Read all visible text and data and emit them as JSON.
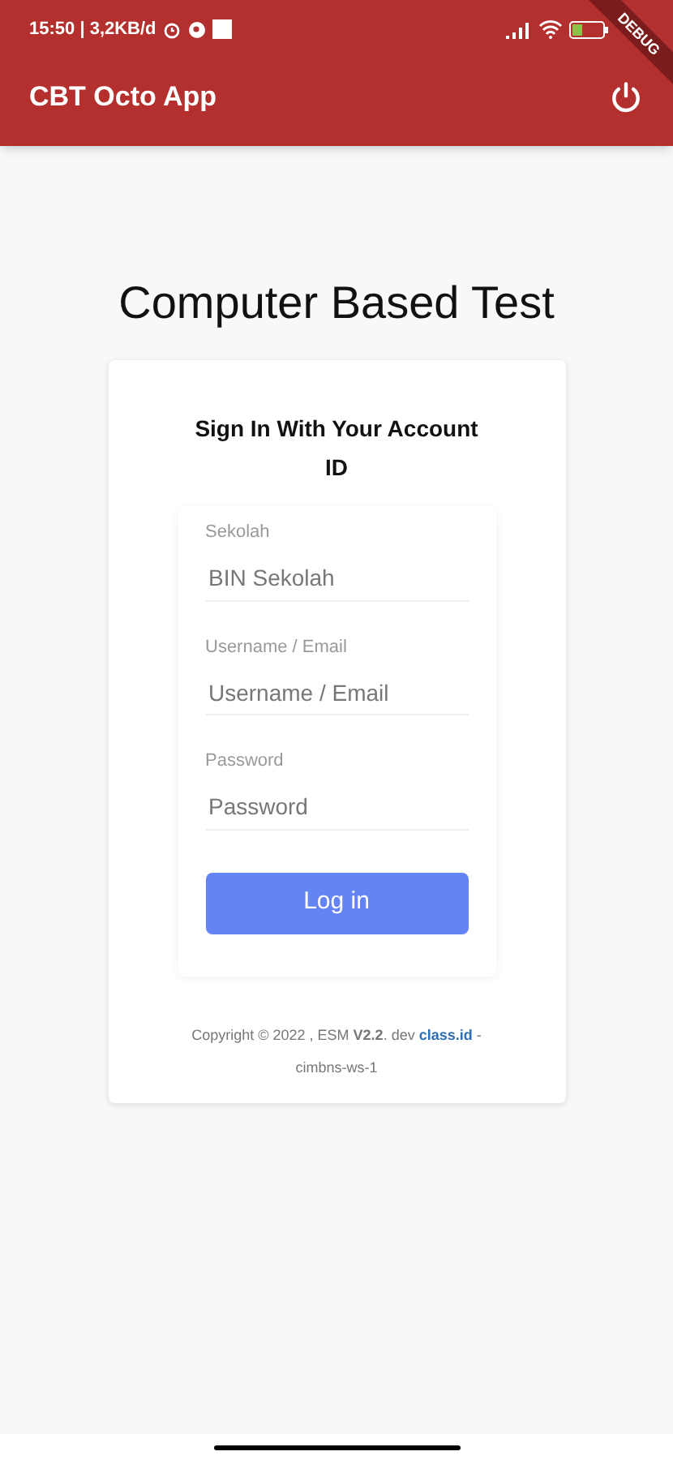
{
  "status_bar": {
    "time": "15:50 | 3,2KB/d"
  },
  "app_bar": {
    "title": "CBT Octo App"
  },
  "debug_banner": {
    "label": "DEBUG"
  },
  "heading": "Computer Based Test",
  "card": {
    "title": "Sign In With Your Account ID",
    "fields": [
      {
        "label": "Sekolah",
        "placeholder": "BIN Sekolah"
      },
      {
        "label": "Username / Email",
        "placeholder": "Username / Email"
      },
      {
        "label": "Password",
        "placeholder": "Password"
      }
    ],
    "button": "Log in",
    "footer": {
      "text": "Copyright © 2022 , ESM **V2.2**. dev",
      "link": "class.id",
      "suffix": "-",
      "line_2": "cimbns-ws-1"
    }
  }
}
